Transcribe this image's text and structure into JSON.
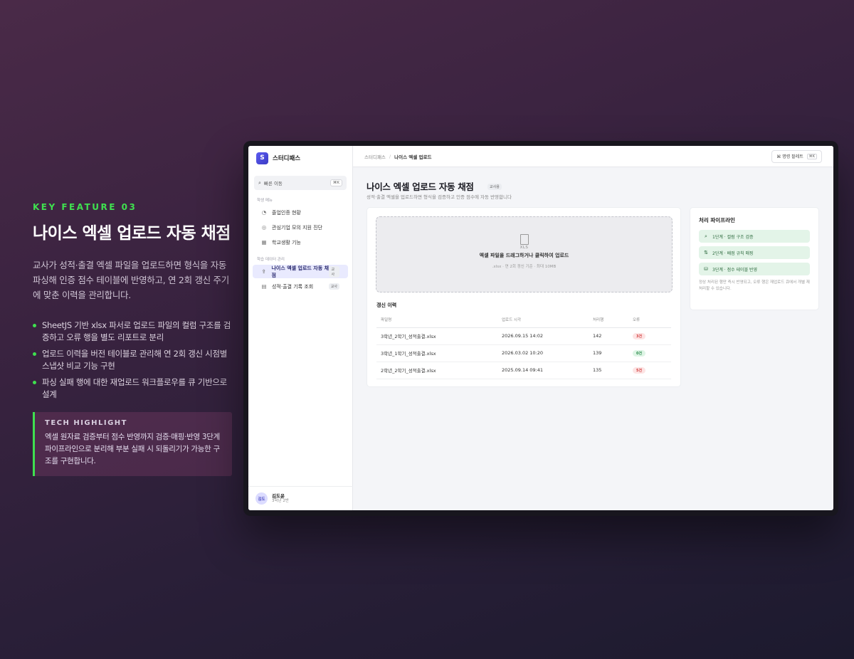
{
  "feature": {
    "kicker": "KEY FEATURE 03",
    "headline": "나이스 엑셀 업로드 자동 채점",
    "description": "교사가 성적·출결 엑셀 파일을 업로드하면 형식을 자동 파싱해 인증 점수 테이블에 반영하고, 연 2회 갱신 주기에 맞춘 이력을 관리합니다.",
    "bullets": [
      "SheetJS 기반 xlsx 파서로 업로드 파일의 컬럼 구조를 검증하고 오류 행을 별도 리포트로 분리",
      "업로드 이력을 버전 테이블로 관리해 연 2회 갱신 시점별 스냅샷 비교 기능 구현",
      "파싱 실패 행에 대한 재업로드 워크플로우를 큐 기반으로 설계"
    ],
    "tech_title": "TECH HIGHLIGHT",
    "tech_text": "엑셀 원자료 검증부터 점수 반영까지 검증·매핑·반영 3단계 파이프라인으로 분리해 부분 실패 시 되돌리기가 가능한 구조를 구현합니다."
  },
  "app": {
    "brand_letter": "S",
    "brand_name": "스터디패스",
    "search_label": "빠른 이동",
    "search_kbd": "⌘K",
    "section_student": "학생 메뉴",
    "section_data": "학습 데이터 관리",
    "nav_student": [
      {
        "label": "졸업인증 현황",
        "icon": "gauge-icon"
      },
      {
        "label": "관심기업 모의 지원 진단",
        "icon": "target-icon"
      },
      {
        "label": "학교생활 기능",
        "icon": "calendar-icon"
      }
    ],
    "nav_data": [
      {
        "label": "나이스 엑셀 업로드 자동 채점",
        "tag": "교사",
        "icon": "upload-icon"
      },
      {
        "label": "성적·출결 기록 조회",
        "tag": "교사",
        "icon": "document-icon"
      }
    ],
    "user": {
      "initials": "김도",
      "name": "김도윤",
      "sub": "3학년 2반"
    }
  },
  "topbar": {
    "crumb_root": "스터디패스",
    "crumb_sep": "/",
    "crumb_current": "나이스 엑셀 업로드",
    "cmd_label": "⌘ 명령 팔레트",
    "cmd_kbd": "⌘K"
  },
  "page": {
    "title": "나이스 엑셀 업로드 자동 채점",
    "badge": "교사용",
    "subtitle": "성적·출결 엑셀을 업로드하면 형식을 검증하고 인증 점수에 자동 반영합니다"
  },
  "dropzone": {
    "file_label": "XLS",
    "title": "엑셀 파일을 드래그하거나 클릭하여 업로드",
    "sub": ".xlsx · 연 2회 갱신 기준 · 최대 10MB"
  },
  "history": {
    "title": "갱신 이력",
    "columns": [
      "파일명",
      "업로드 시각",
      "처리행",
      "오류"
    ],
    "rows": [
      {
        "file": "3학년_2학기_성적출결.xlsx",
        "time": "2026.09.15 14:02",
        "count": "142",
        "errors": "3건",
        "status": "red"
      },
      {
        "file": "3학년_1학기_성적출결.xlsx",
        "time": "2026.03.02 10:20",
        "count": "139",
        "errors": "0건",
        "status": "green"
      },
      {
        "file": "2학년_2학기_성적출결.xlsx",
        "time": "2025.09.14 09:41",
        "count": "135",
        "errors": "5건",
        "status": "red"
      }
    ]
  },
  "pipeline": {
    "title": "처리 파이프라인",
    "steps": [
      {
        "label": "1단계 · 컬럼 구조 검증",
        "icon": "search-icon"
      },
      {
        "label": "2단계 · 배점 규칙 매핑",
        "icon": "swap-icon"
      },
      {
        "label": "3단계 · 점수 테이블 반영",
        "icon": "database-icon"
      }
    ],
    "note": "정상 처리된 행만 즉시 반영되고, 오류 행은 재업로드 큐에서 개별 재처리할 수 있습니다."
  },
  "colors": {
    "accent": "#3fe04f",
    "brand": "#4a4ad8"
  }
}
